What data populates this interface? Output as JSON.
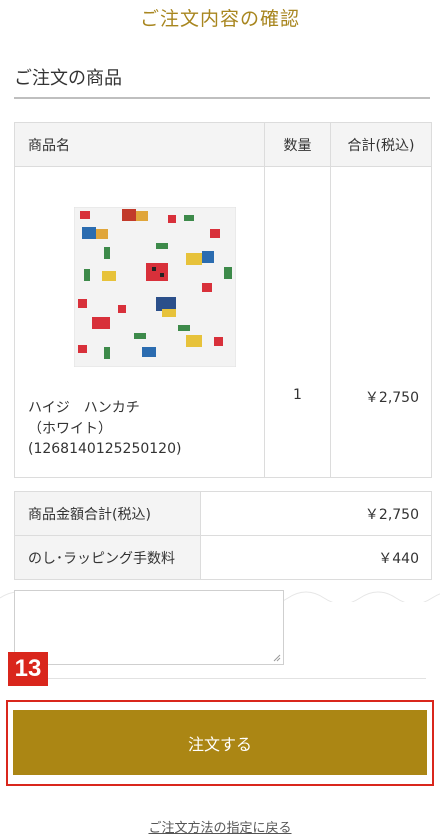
{
  "page": {
    "title": "ご注文内容の確認"
  },
  "section": {
    "heading": "ご注文の商品"
  },
  "items_table": {
    "headers": {
      "name": "商品名",
      "qty": "数量",
      "total": "合計(税込)"
    },
    "rows": [
      {
        "name_line1": "ハイジ　ハンカチ",
        "name_line2": "（ホワイト）",
        "name_line3": "(1268140125250120)",
        "qty": "1",
        "total": "￥2,750"
      }
    ]
  },
  "summary": {
    "rows": [
      {
        "label": "商品金額合計(税込)",
        "value": "￥2,750"
      },
      {
        "label": "のし･ラッピング手数料",
        "value": "￥440"
      }
    ]
  },
  "step_badge": "13",
  "order_button": {
    "label": "注文する"
  },
  "back_link": {
    "label": "ご注文方法の指定に戻る"
  },
  "colors": {
    "accent_gold": "#ab8614",
    "title_gold": "#a8861f",
    "highlight_red": "#d9261c"
  }
}
